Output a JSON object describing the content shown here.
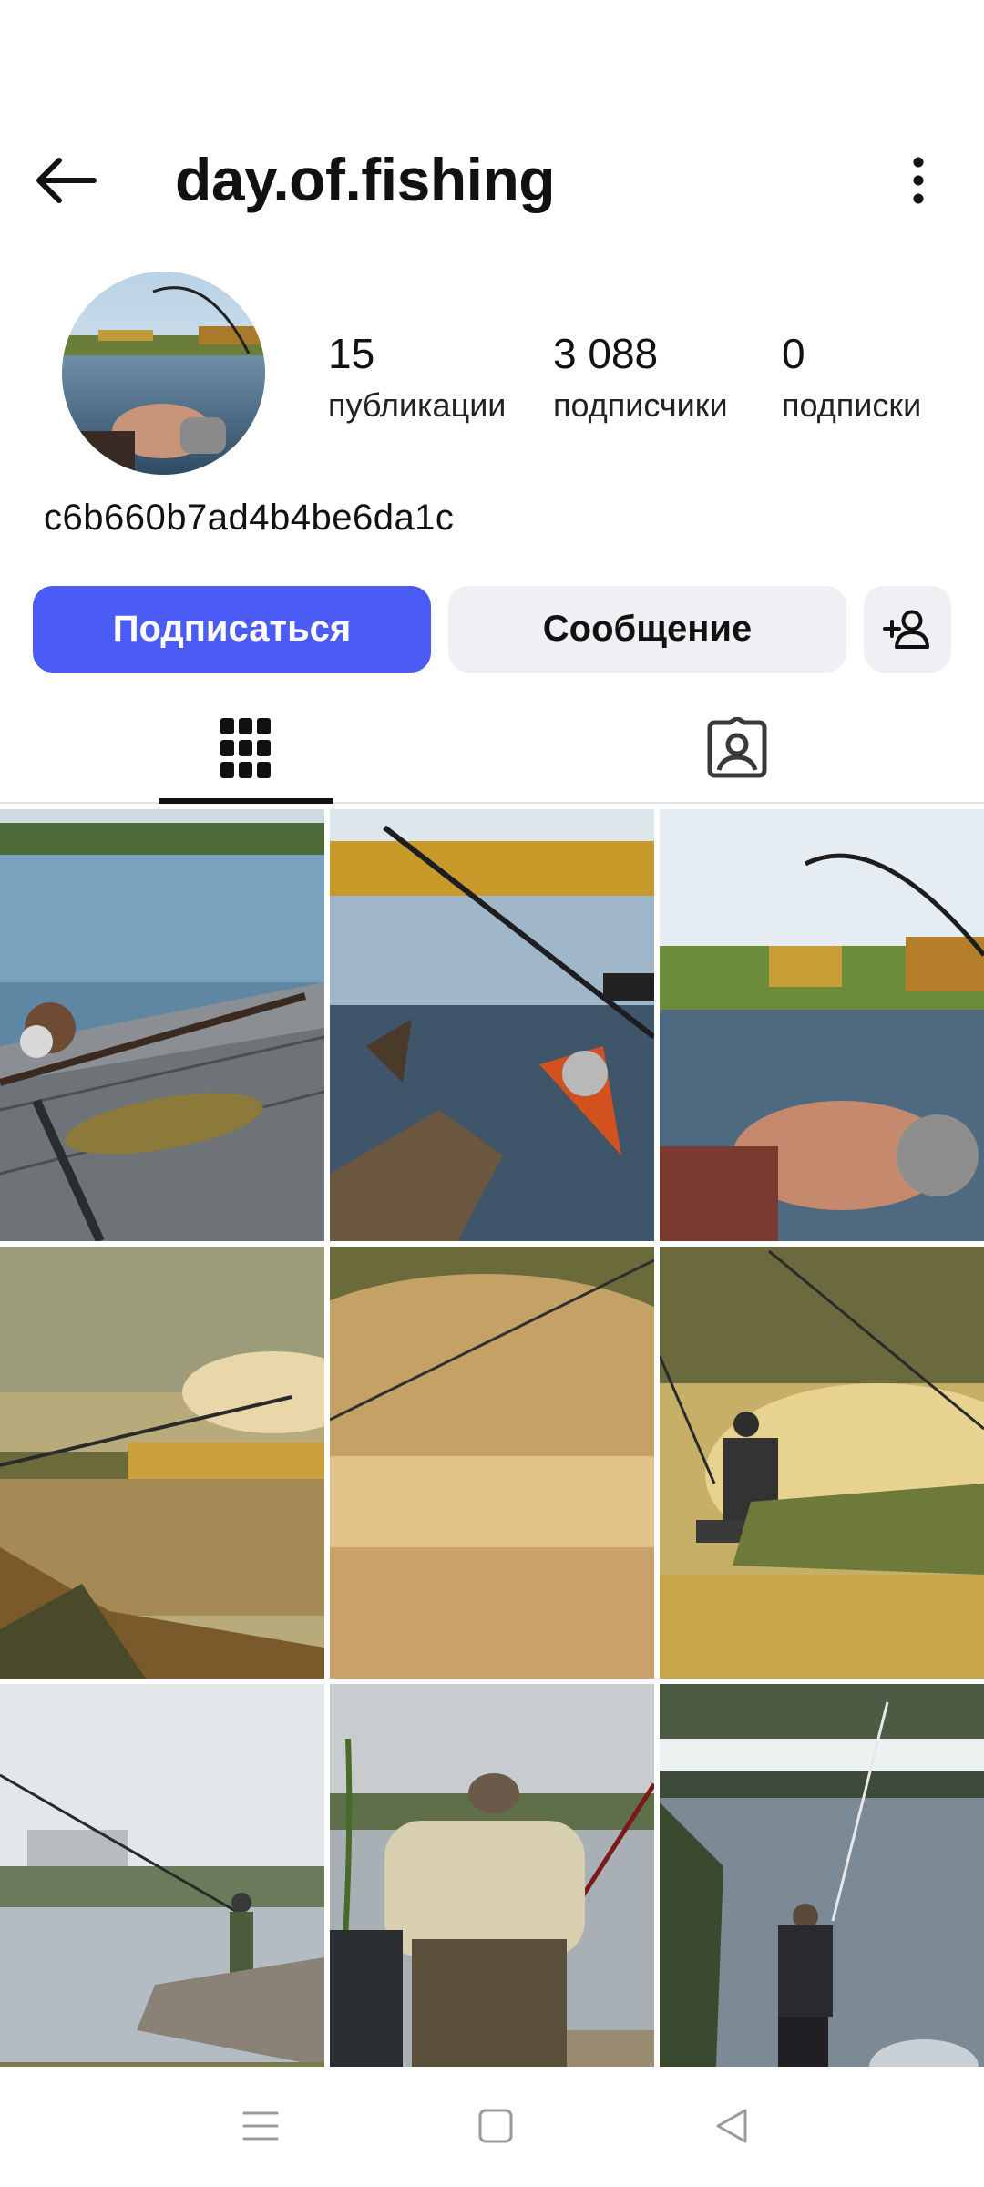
{
  "header": {
    "title": "day.of.fishing",
    "back_icon": "arrow-left-icon",
    "menu_icon": "more-vertical-icon"
  },
  "profile": {
    "username": "c6b660b7ad4b4be6da1c",
    "stats": [
      {
        "value": "15",
        "label": "публикации"
      },
      {
        "value": "3 088",
        "label": "подписчики"
      },
      {
        "value": "0",
        "label": "подписки"
      }
    ]
  },
  "actions": {
    "follow_label": "Подписаться",
    "message_label": "Сообщение",
    "add_user_icon": "add-user-icon"
  },
  "tabs": [
    {
      "icon": "grid-icon",
      "active": true
    },
    {
      "icon": "tagged-user-icon",
      "active": false
    }
  ],
  "posts": [
    {
      "subject": "pike-on-pier"
    },
    {
      "subject": "rod-reel-lake-sunset"
    },
    {
      "subject": "hand-reel-lake"
    },
    {
      "subject": "rod-river-sunset"
    },
    {
      "subject": "misty-golden-water"
    },
    {
      "subject": "angler-silhouette-reeds"
    },
    {
      "subject": "angler-city-shore"
    },
    {
      "subject": "angler-camo-chair"
    },
    {
      "subject": "angler-standing-water"
    }
  ],
  "navbar": {
    "menu_icon": "menu-icon",
    "home_icon": "home-square-icon",
    "back_icon": "back-triangle-icon"
  },
  "colors": {
    "accent": "#4a5cf5",
    "button_secondary": "#eff0f3"
  }
}
